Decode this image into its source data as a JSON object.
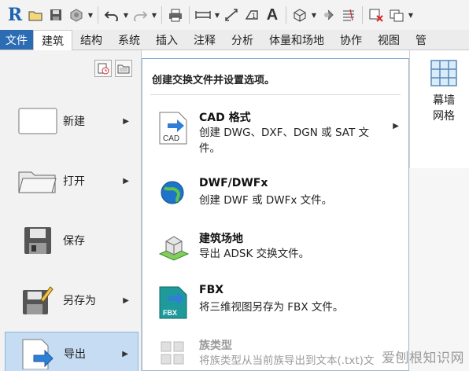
{
  "quick_access": {
    "app_logo": "R",
    "icons": [
      "open-icon",
      "save-icon",
      "sync-icon",
      "undo-icon",
      "redo-icon",
      "print-icon",
      "measure-icon",
      "dimension-icon",
      "tag-icon",
      "text-icon",
      "view-3d-icon",
      "section-icon",
      "thin-lines-icon",
      "close-views-icon",
      "switch-windows-icon"
    ]
  },
  "tabs": [
    "文件",
    "建筑",
    "结构",
    "系统",
    "插入",
    "注释",
    "分析",
    "体量和场地",
    "协作",
    "视图",
    "管"
  ],
  "active_tab": "建筑",
  "ribbon": {
    "curtain_label_1": "幕墙",
    "curtain_label_2": "网格"
  },
  "app_menu": {
    "items": [
      {
        "label": "新建",
        "icon": "new-icon",
        "has_arrow": true
      },
      {
        "label": "打开",
        "icon": "folder-icon",
        "has_arrow": true
      },
      {
        "label": "保存",
        "icon": "save-icon",
        "has_arrow": false
      },
      {
        "label": "另存为",
        "icon": "save-as-icon",
        "has_arrow": true
      },
      {
        "label": "导出",
        "icon": "export-icon",
        "has_arrow": true,
        "selected": true
      }
    ]
  },
  "export_panel": {
    "header": "创建交换文件并设置选项。",
    "options": [
      {
        "title": "CAD 格式",
        "desc": "创建 DWG、DXF、DGN 或 SAT 文件。",
        "has_arrow": true,
        "icon": "cad-icon"
      },
      {
        "title": "DWF/DWFx",
        "desc": "创建 DWF 或 DWFx 文件。",
        "icon": "dwf-globe-icon"
      },
      {
        "title": "建筑场地",
        "desc": "导出 ADSK 交换文件。",
        "icon": "building-site-icon"
      },
      {
        "title": "FBX",
        "desc": "将三维视图另存为 FBX 文件。",
        "icon": "fbx-icon"
      },
      {
        "title": "族类型",
        "desc": "将族类型从当前族导出到文本(.txt)文",
        "icon": "family-types-icon",
        "disabled": true
      }
    ]
  },
  "watermark": "爱刨根知识网",
  "colors": {
    "file_tab": "#2b6cb3",
    "selected_item": "#c5dcf2",
    "panel_border": "#7aa6d6"
  }
}
